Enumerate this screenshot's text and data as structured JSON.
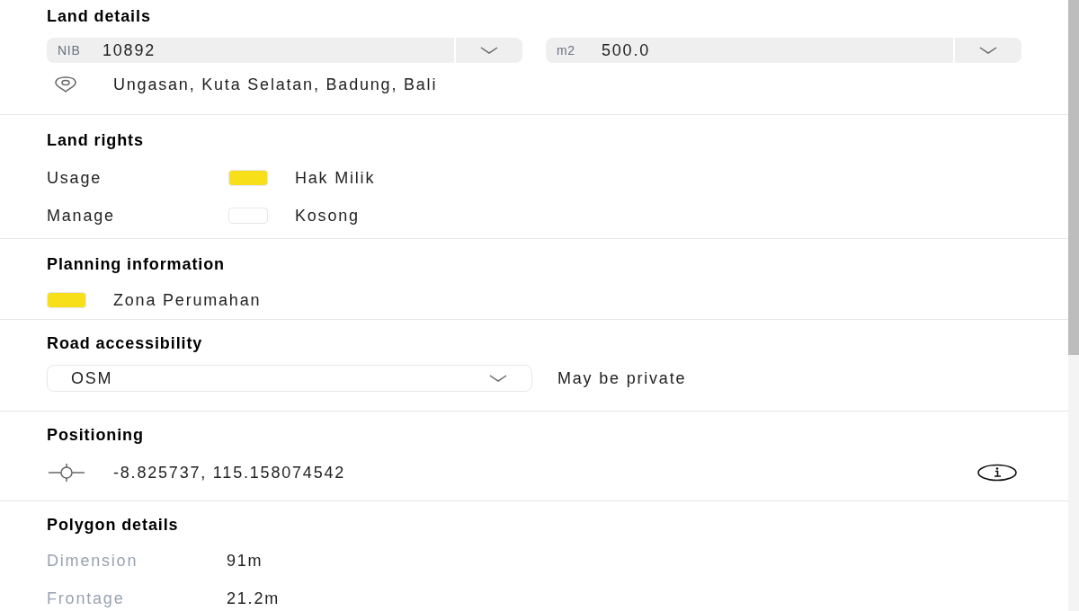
{
  "land_details": {
    "title": "Land details",
    "fields": [
      {
        "prefix": "NIB",
        "value": "10892"
      },
      {
        "prefix": "m2",
        "value": "500.0"
      }
    ],
    "address": "Ungasan, Kuta Selatan, Badung, Bali"
  },
  "land_rights": {
    "title": "Land rights",
    "rows": [
      {
        "label": "Usage",
        "color": "#f7e019",
        "value": "Hak Milik"
      },
      {
        "label": "Manage",
        "color": "#ffffff",
        "value": "Kosong"
      }
    ]
  },
  "planning": {
    "title": "Planning information",
    "zones": [
      {
        "color": "#f7e019",
        "label": "Zona Perumahan"
      }
    ]
  },
  "road": {
    "title": "Road accessibility",
    "source": "OSM",
    "note": "May be private"
  },
  "positioning": {
    "title": "Positioning",
    "coordinates": "-8.825737, 115.158074542"
  },
  "polygon": {
    "title": "Polygon details",
    "rows": [
      {
        "label": "Dimension",
        "value": "91m"
      },
      {
        "label": "Frontage",
        "value": "21.2m"
      }
    ]
  }
}
